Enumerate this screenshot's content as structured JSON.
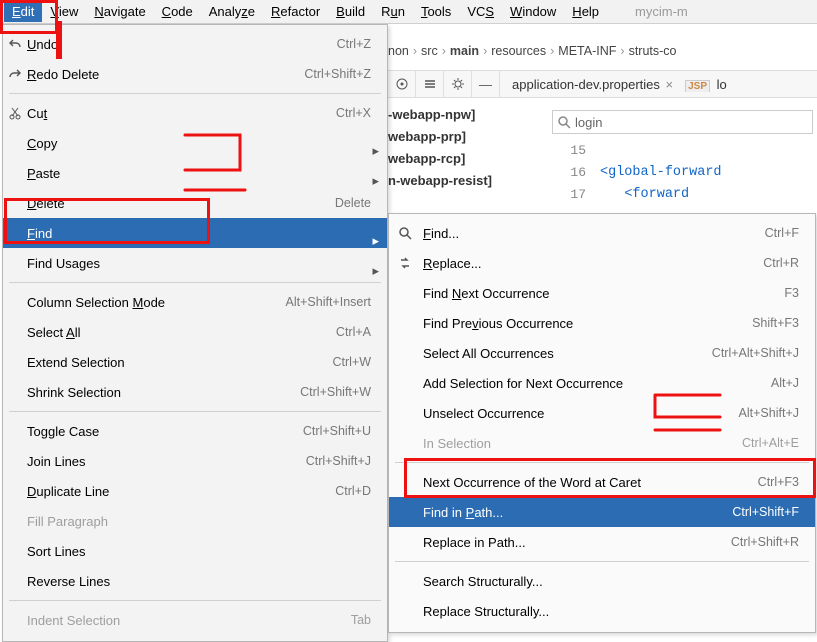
{
  "menubar": {
    "items": [
      {
        "label": "Edit",
        "u": "E",
        "sel": true
      },
      {
        "label": "View",
        "u": "V"
      },
      {
        "label": "Navigate",
        "u": "N"
      },
      {
        "label": "Code",
        "u": "C"
      },
      {
        "label": "Analyze",
        "u": "z"
      },
      {
        "label": "Refactor",
        "u": "R"
      },
      {
        "label": "Build",
        "u": "B"
      },
      {
        "label": "Run",
        "u": "u"
      },
      {
        "label": "Tools",
        "u": "T"
      },
      {
        "label": "VCS",
        "u": "S"
      },
      {
        "label": "Window",
        "u": "W"
      },
      {
        "label": "Help",
        "u": "H"
      }
    ],
    "tail": "mycim-m"
  },
  "breadcrumb": {
    "parts": [
      "non",
      "src",
      "main",
      "resources",
      "META-INF",
      "struts-co"
    ],
    "boldIndex": 2
  },
  "toolstrip": {
    "tab1": "application-dev.properties",
    "tab2": "lo"
  },
  "projtree": [
    "-webapp-npw]",
    "webapp-prp]",
    "webapp-rcp]",
    "n-webapp-resist]"
  ],
  "search": {
    "placeholder": "login"
  },
  "gutter": [
    "15",
    "16",
    "17"
  ],
  "code": {
    "l1": "",
    "l2a": "<",
    "l2b": "global-forward",
    "l3a": "<",
    "l3b": "forward"
  },
  "editmenu": [
    {
      "t": "item",
      "label": "Undo",
      "accel": "Ctrl+Z",
      "u": "U",
      "icon": "undo"
    },
    {
      "t": "item",
      "label": "Redo Delete",
      "accel": "Ctrl+Shift+Z",
      "u": "R",
      "icon": "redo"
    },
    {
      "t": "div"
    },
    {
      "t": "item",
      "label": "Cut",
      "accel": "Ctrl+X",
      "u": "t",
      "icon": "cut"
    },
    {
      "t": "item",
      "label": "Copy",
      "sub": true,
      "u": "C"
    },
    {
      "t": "item",
      "label": "Paste",
      "sub": true,
      "u": "P"
    },
    {
      "t": "item",
      "label": "Delete",
      "accel": "Delete",
      "u": "D"
    },
    {
      "t": "item",
      "label": "Find",
      "sub": true,
      "sel": true,
      "u": "F"
    },
    {
      "t": "item",
      "label": "Find Usages",
      "sub": true,
      "u": "g"
    },
    {
      "t": "div"
    },
    {
      "t": "item",
      "label": "Column Selection Mode",
      "accel": "Alt+Shift+Insert",
      "u": "M"
    },
    {
      "t": "item",
      "label": "Select All",
      "accel": "Ctrl+A",
      "u": "A"
    },
    {
      "t": "item",
      "label": "Extend Selection",
      "accel": "Ctrl+W"
    },
    {
      "t": "item",
      "label": "Shrink Selection",
      "accel": "Ctrl+Shift+W"
    },
    {
      "t": "div"
    },
    {
      "t": "item",
      "label": "Toggle Case",
      "accel": "Ctrl+Shift+U"
    },
    {
      "t": "item",
      "label": "Join Lines",
      "accel": "Ctrl+Shift+J"
    },
    {
      "t": "item",
      "label": "Duplicate Line",
      "accel": "Ctrl+D",
      "u": "D"
    },
    {
      "t": "item",
      "label": "Fill Paragraph",
      "disabled": true
    },
    {
      "t": "item",
      "label": "Sort Lines"
    },
    {
      "t": "item",
      "label": "Reverse Lines"
    },
    {
      "t": "div"
    },
    {
      "t": "item",
      "label": "Indent Selection",
      "accel": "Tab",
      "disabled": true
    }
  ],
  "findmenu": [
    {
      "t": "item",
      "label": "Find...",
      "accel": "Ctrl+F",
      "u": "F",
      "icon": "search"
    },
    {
      "t": "item",
      "label": "Replace...",
      "accel": "Ctrl+R",
      "u": "R",
      "icon": "replace"
    },
    {
      "t": "item",
      "label": "Find Next Occurrence",
      "accel": "F3",
      "u": "N"
    },
    {
      "t": "item",
      "label": "Find Previous Occurrence",
      "accel": "Shift+F3",
      "u": "v"
    },
    {
      "t": "item",
      "label": "Select All Occurrences",
      "accel": "Ctrl+Alt+Shift+J"
    },
    {
      "t": "item",
      "label": "Add Selection for Next Occurrence",
      "accel": "Alt+J"
    },
    {
      "t": "item",
      "label": "Unselect Occurrence",
      "accel": "Alt+Shift+J"
    },
    {
      "t": "item",
      "label": "In Selection",
      "accel": "Ctrl+Alt+E",
      "disabled": true
    },
    {
      "t": "div"
    },
    {
      "t": "item",
      "label": "Next Occurrence of the Word at Caret",
      "accel": "Ctrl+F3"
    },
    {
      "t": "item",
      "label": "Find in Path...",
      "accel": "Ctrl+Shift+F",
      "u": "P",
      "sel": true
    },
    {
      "t": "item",
      "label": "Replace in Path...",
      "accel": "Ctrl+Shift+R"
    },
    {
      "t": "div"
    },
    {
      "t": "item",
      "label": "Search Structurally..."
    },
    {
      "t": "item",
      "label": "Replace Structurally..."
    }
  ]
}
